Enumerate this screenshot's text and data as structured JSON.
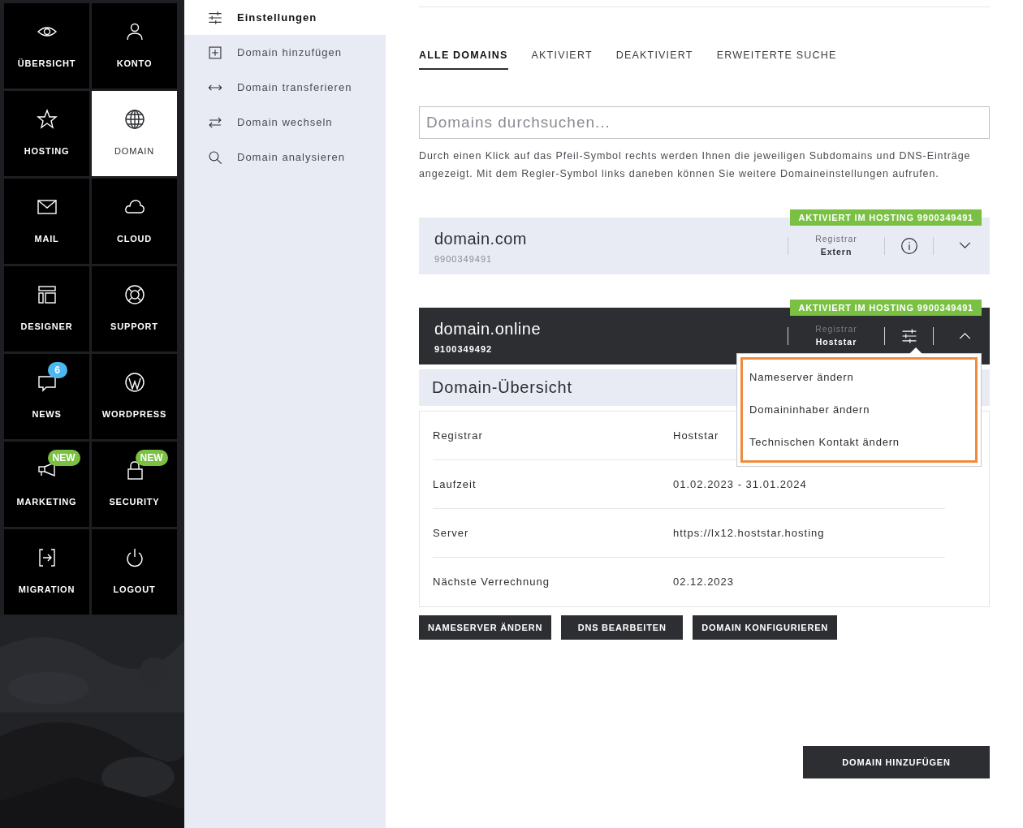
{
  "nav_tiles": [
    {
      "label": "ÜBERSICHT",
      "selected": false
    },
    {
      "label": "KONTO",
      "selected": false
    },
    {
      "label": "HOSTING",
      "selected": false
    },
    {
      "label": "DOMAIN",
      "selected": true
    },
    {
      "label": "MAIL",
      "selected": false
    },
    {
      "label": "CLOUD",
      "selected": false
    },
    {
      "label": "DESIGNER",
      "selected": false
    },
    {
      "label": "SUPPORT",
      "selected": false
    },
    {
      "label": "NEWS",
      "selected": false,
      "badge": {
        "text": "6",
        "kind": "count"
      }
    },
    {
      "label": "WORDPRESS",
      "selected": false
    },
    {
      "label": "MARKETING",
      "selected": false,
      "badge": {
        "text": "NEW",
        "kind": "new"
      }
    },
    {
      "label": "SECURITY",
      "selected": false,
      "badge": {
        "text": "NEW",
        "kind": "new"
      }
    },
    {
      "label": "MIGRATION",
      "selected": false
    },
    {
      "label": "LOGOUT",
      "selected": false
    }
  ],
  "sub_menu": [
    {
      "label": "Einstellungen",
      "selected": true
    },
    {
      "label": "Domain hinzufügen",
      "selected": false
    },
    {
      "label": "Domain transferieren",
      "selected": false
    },
    {
      "label": "Domain wechseln",
      "selected": false
    },
    {
      "label": "Domain analysieren",
      "selected": false
    }
  ],
  "tabs": [
    {
      "label": "ALLE DOMAINS",
      "selected": true
    },
    {
      "label": "AKTIVIERT",
      "selected": false
    },
    {
      "label": "DEAKTIVIERT",
      "selected": false
    },
    {
      "label": "ERWEITERTE SUCHE",
      "selected": false
    }
  ],
  "search": {
    "placeholder": "Domains durchsuchen..."
  },
  "help_text": "Durch einen Klick auf das Pfeil-Symbol rechts werden Ihnen die jeweiligen Subdomains und DNS-Einträge angezeigt. Mit dem Regler-Symbol links daneben können Sie weitere Domaineinstellungen aufrufen.",
  "domains": [
    {
      "name": "domain.com",
      "number": "9900349491",
      "status": "AKTIVIERT IM HOSTING 9900349491",
      "registrar_label": "Registrar",
      "registrar": "Extern",
      "kind": "info",
      "expanded": false
    },
    {
      "name": "domain.online",
      "number": "9100349492",
      "status": "AKTIVIERT IM HOSTING 9900349491",
      "registrar_label": "Registrar",
      "registrar": "Hoststar",
      "kind": "settings",
      "expanded": true
    }
  ],
  "settings_menu": {
    "highlighted": true,
    "items": [
      "Nameserver ändern",
      "Domaininhaber ändern",
      "Technischen Kontakt ändern"
    ]
  },
  "overview": {
    "title": "Domain-Übersicht",
    "rows": [
      {
        "label": "Registrar",
        "value": "Hoststar"
      },
      {
        "label": "Laufzeit",
        "value": "01.02.2023 - 31.01.2024"
      },
      {
        "label": "Server",
        "value": "https://lx12.hoststar.hosting"
      },
      {
        "label": "Nächste Verrechnung",
        "value": "02.12.2023"
      }
    ],
    "buttons": [
      "NAMESERVER ÄNDERN",
      "DNS BEARBEITEN",
      "DOMAIN KONFIGURIEREN"
    ]
  },
  "add_button": "DOMAIN HINZUFÜGEN"
}
